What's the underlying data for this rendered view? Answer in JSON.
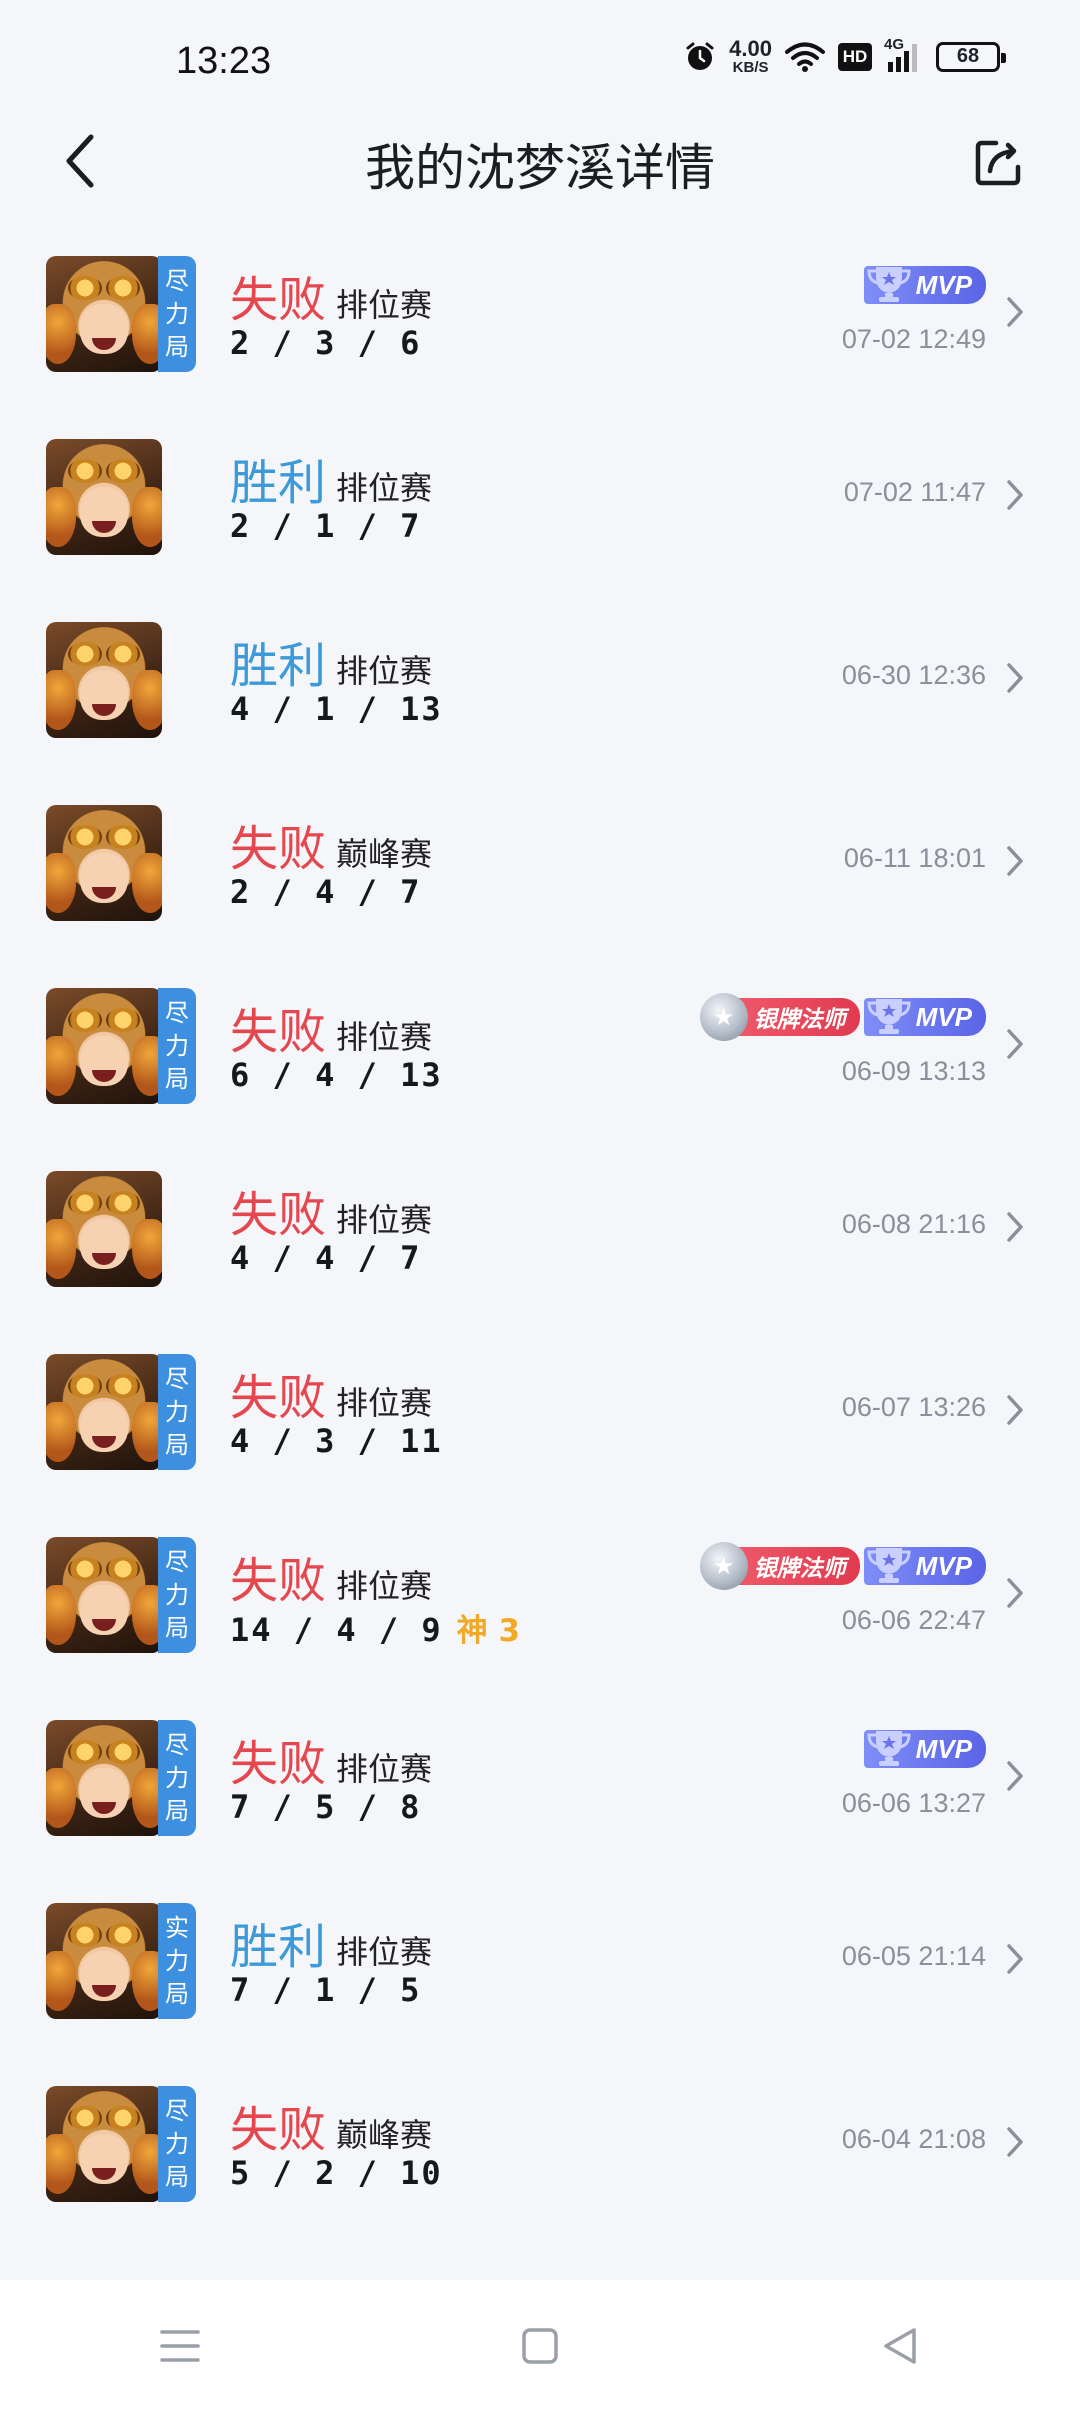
{
  "status_bar": {
    "time": "13:23",
    "net_speed_value": "4.00",
    "net_speed_unit": "KB/S",
    "hd_label": "HD",
    "network_label": "4G",
    "battery": "68"
  },
  "header": {
    "title": "我的沈梦溪详情"
  },
  "matches": [
    {
      "result": "失败",
      "type": "lose",
      "mode": "排位赛",
      "kda": "2 / 3 / 6",
      "streak": "",
      "tag": [
        "尽",
        "力",
        "局"
      ],
      "badges": [
        "mvp"
      ],
      "datetime": "07-02 12:49"
    },
    {
      "result": "胜利",
      "type": "win",
      "mode": "排位赛",
      "kda": "2 / 1 / 7",
      "streak": "",
      "tag": [],
      "badges": [],
      "datetime": "07-02 11:47"
    },
    {
      "result": "胜利",
      "type": "win",
      "mode": "排位赛",
      "kda": "4 / 1 / 13",
      "streak": "",
      "tag": [],
      "badges": [],
      "datetime": "06-30 12:36"
    },
    {
      "result": "失败",
      "type": "lose",
      "mode": "巅峰赛",
      "kda": "2 / 4 / 7",
      "streak": "",
      "tag": [],
      "badges": [],
      "datetime": "06-11 18:01"
    },
    {
      "result": "失败",
      "type": "lose",
      "mode": "排位赛",
      "kda": "6 / 4 / 13",
      "streak": "",
      "tag": [
        "尽",
        "力",
        "局"
      ],
      "badges": [
        "silver",
        "mvp"
      ],
      "datetime": "06-09 13:13"
    },
    {
      "result": "失败",
      "type": "lose",
      "mode": "排位赛",
      "kda": "4 / 4 / 7",
      "streak": "",
      "tag": [],
      "badges": [],
      "datetime": "06-08 21:16"
    },
    {
      "result": "失败",
      "type": "lose",
      "mode": "排位赛",
      "kda": "4 / 3 / 11",
      "streak": "",
      "tag": [
        "尽",
        "力",
        "局"
      ],
      "badges": [],
      "datetime": "06-07 13:26"
    },
    {
      "result": "失败",
      "type": "lose",
      "mode": "排位赛",
      "kda": "14 / 4 / 9",
      "streak": "神 3",
      "tag": [
        "尽",
        "力",
        "局"
      ],
      "badges": [
        "silver",
        "mvp"
      ],
      "datetime": "06-06 22:47"
    },
    {
      "result": "失败",
      "type": "lose",
      "mode": "排位赛",
      "kda": "7 / 5 / 8",
      "streak": "",
      "tag": [
        "尽",
        "力",
        "局"
      ],
      "badges": [
        "mvp"
      ],
      "datetime": "06-06 13:27"
    },
    {
      "result": "胜利",
      "type": "win",
      "mode": "排位赛",
      "kda": "7 / 1 / 5",
      "streak": "",
      "tag": [
        "实",
        "力",
        "局"
      ],
      "badges": [],
      "datetime": "06-05 21:14"
    },
    {
      "result": "失败",
      "type": "lose",
      "mode": "巅峰赛",
      "kda": "5 / 2 / 10",
      "streak": "",
      "tag": [
        "尽",
        "力",
        "局"
      ],
      "badges": [],
      "datetime": "06-04 21:08"
    }
  ],
  "badge_labels": {
    "silver": "银牌法师",
    "mvp": "MVP"
  },
  "colors": {
    "lose": "#e5474f",
    "win": "#3d9ad8",
    "tag": "#3d8fe0",
    "mvp": "#5a64e6",
    "silver_badge": "#e03a4e",
    "streak": "#f3a928"
  },
  "icons": {
    "back": "chevron-left-icon",
    "share": "share-icon",
    "row_arrow": "chevron-right-icon",
    "nav_menu": "menu-icon",
    "nav_home": "square-home-icon",
    "nav_back": "triangle-back-icon"
  }
}
